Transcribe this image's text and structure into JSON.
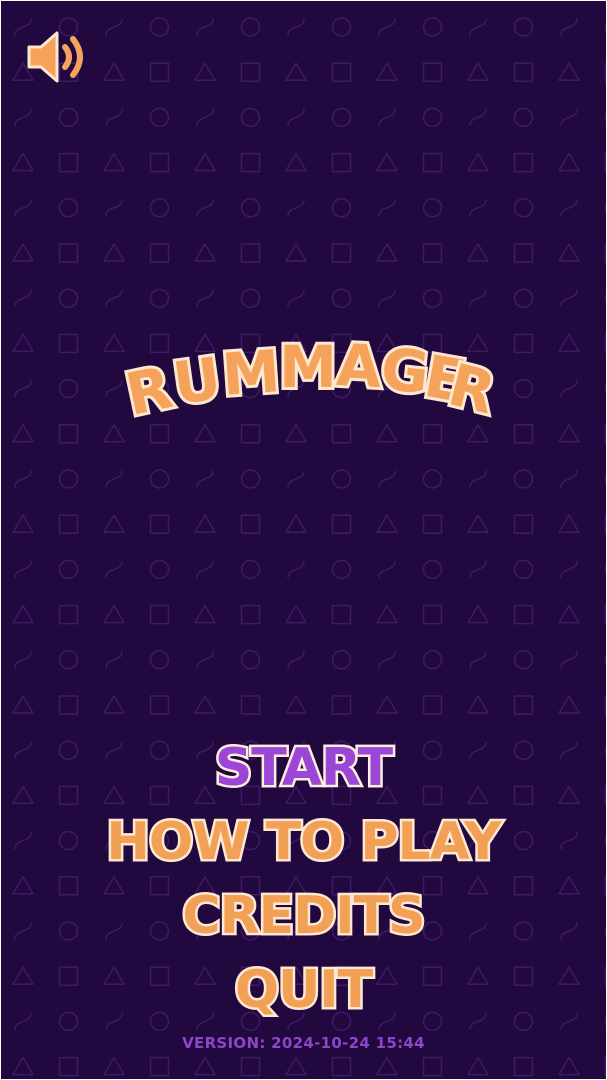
{
  "title": {
    "text": "RUMMAGER",
    "letters": [
      "R",
      "U",
      "M",
      "M",
      "A",
      "G",
      "E",
      "R"
    ]
  },
  "sound": {
    "icon": "speaker-on-icon"
  },
  "menu": {
    "items": [
      {
        "label": "START",
        "active": true
      },
      {
        "label": "HOW TO PLAY",
        "active": false
      },
      {
        "label": "CREDITS",
        "active": false
      },
      {
        "label": "QUIT",
        "active": false
      }
    ]
  },
  "version": {
    "label": "VERSION: 2024-10-24 15:44"
  },
  "colors": {
    "background": "#21093f",
    "pattern": "#3d1a66",
    "accent_orange": "#f5a35a",
    "outline_cream": "#fde7cf",
    "active_purple": "#9b46d6",
    "version_purple": "#8d45c9"
  },
  "background_pattern": {
    "shapes": [
      "wave",
      "circle",
      "triangle",
      "square"
    ]
  }
}
